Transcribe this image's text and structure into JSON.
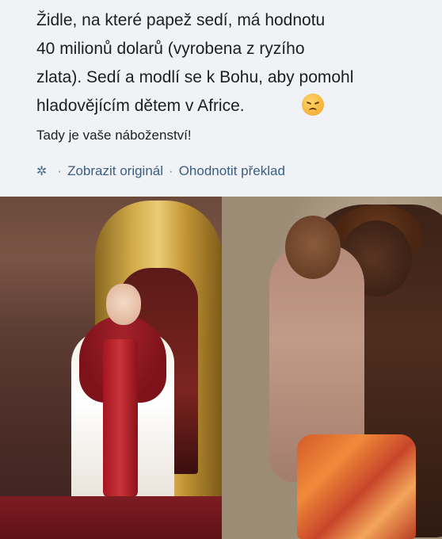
{
  "post": {
    "lines": [
      "Židle, na které papež sedí, má hodnotu",
      "40 milionů dolarů (vyrobena z ryzího",
      "zlata). Sedí a modlí se k Bohu, aby pomohl",
      "hladovějícím dětem v Africe."
    ],
    "emoji": "sad-face-emoji",
    "subline": "Tady je vaše náboženství!"
  },
  "actions": {
    "icon": "gear-icon",
    "show_original": "Zobrazit originál",
    "separator": "·",
    "rate_translation": "Ohodnotit překlad"
  },
  "colors": {
    "background": "#f0f2f5",
    "link": "#3b5f83"
  }
}
